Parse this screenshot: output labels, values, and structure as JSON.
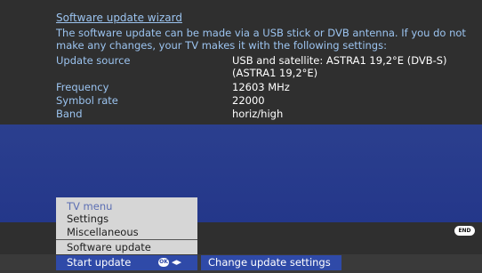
{
  "wizard": {
    "title": "Software update wizard",
    "intro": "The software update can be made via a USB stick or DVB antenna. If you do not make any changes, your TV makes it with the following settings:"
  },
  "settings": [
    {
      "label": "Update source",
      "value": "USB and satellite: ASTRA1 19,2°E (DVB-S)\n(ASTRA1 19,2°E)"
    },
    {
      "label": "Frequency",
      "value": "12603 MHz"
    },
    {
      "label": "Symbol rate",
      "value": "22000"
    },
    {
      "label": "Band",
      "value": "horiz/high"
    }
  ],
  "menu": {
    "title": "TV menu",
    "items": [
      "Settings",
      "Miscellaneous",
      "Software update"
    ],
    "selected": "Start update"
  },
  "footer": {
    "ok_icon": "OK",
    "nav_icon": "◂▸",
    "change_label": "Change update settings",
    "end_badge": "END"
  },
  "colors": {
    "accent_blue": "#2f4aa8",
    "panel_gray": "#2f2f2f",
    "label_blue": "#9cc4f0"
  }
}
